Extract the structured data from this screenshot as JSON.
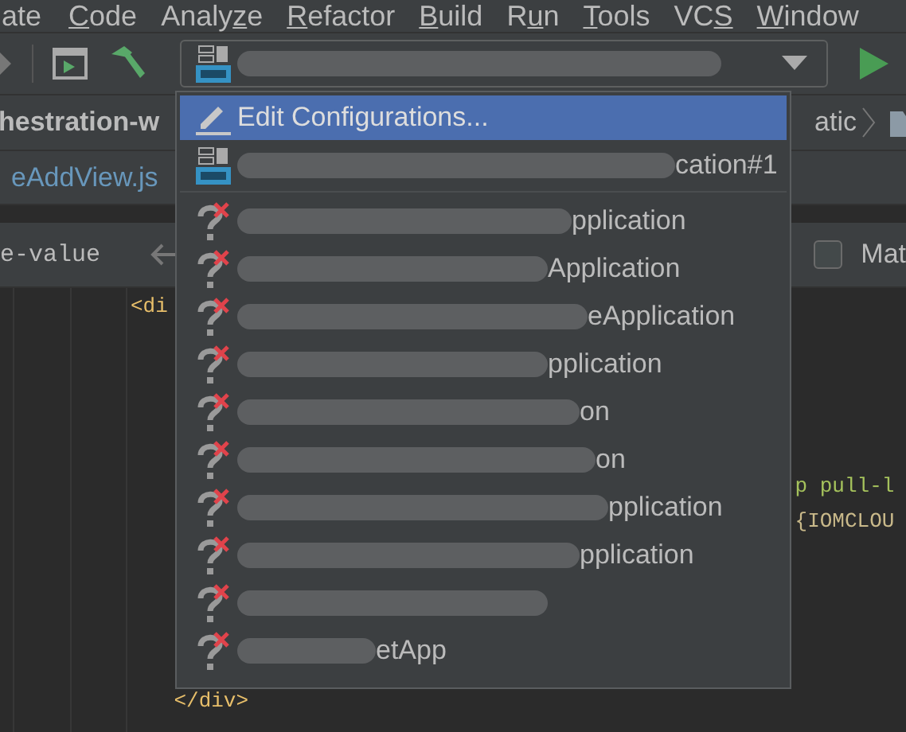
{
  "menu_bar": [
    {
      "before": "ate"
    },
    {
      "key": "C",
      "after": "ode"
    },
    {
      "before": "Analy",
      "key": "z",
      "after": "e"
    },
    {
      "key": "R",
      "after": "efactor"
    },
    {
      "key": "B",
      "after": "uild"
    },
    {
      "before": "R",
      "key": "u",
      "after": "n"
    },
    {
      "key": "T",
      "after": "ools"
    },
    {
      "before": "VC",
      "key": "S"
    },
    {
      "key": "W",
      "after": "indow"
    }
  ],
  "run_config": {
    "redacted": true
  },
  "breadcrumb": {
    "project": "hestration-w",
    "path_end": "atic"
  },
  "editor_tab": {
    "label": "eAddView.js"
  },
  "find_bar": {
    "value": "e-value",
    "match_case": {
      "label": "Mat",
      "checked": false
    }
  },
  "code_lines": [
    {
      "text": "<di",
      "kind": "tag"
    },
    {
      "kind": "blank"
    },
    {
      "kind": "blank"
    },
    {
      "kind": "blank"
    },
    {
      "kind": "blank"
    },
    {
      "text": "                                                                p pull-l",
      "kind": "string"
    },
    {
      "text": "                                                                {IOMCLOU",
      "kind": "plain"
    },
    {
      "kind": "blank"
    },
    {
      "kind": "blank"
    },
    {
      "kind": "blank"
    },
    {
      "kind": "blank"
    },
    {
      "text": "              </div>",
      "kind": "tag"
    }
  ],
  "config_menu": [
    {
      "kind": "action",
      "text": "Edit Configurations...",
      "selected": true
    },
    {
      "kind": "api",
      "text": "cation#1",
      "redacted": true,
      "selected": false
    },
    {
      "kind": "unknown",
      "text": "pplication",
      "redacted": true,
      "selected": false
    },
    {
      "kind": "unknown",
      "text": "Application",
      "redacted": true,
      "selected": false
    },
    {
      "kind": "unknown",
      "text": "eApplication",
      "redacted": true,
      "selected": false
    },
    {
      "kind": "unknown",
      "text": "pplication",
      "redacted": true,
      "selected": false
    },
    {
      "kind": "unknown",
      "text": "on",
      "redacted": true,
      "selected": false
    },
    {
      "kind": "unknown",
      "text": "on",
      "redacted": true,
      "selected": false
    },
    {
      "kind": "unknown",
      "text": "pplication",
      "redacted": true,
      "selected": false
    },
    {
      "kind": "unknown",
      "text": "pplication",
      "redacted": true,
      "selected": false
    },
    {
      "kind": "unknown",
      "redacted": true,
      "selected": false
    },
    {
      "kind": "unknown",
      "text": "etApp",
      "redacted": true,
      "selected": false
    }
  ]
}
